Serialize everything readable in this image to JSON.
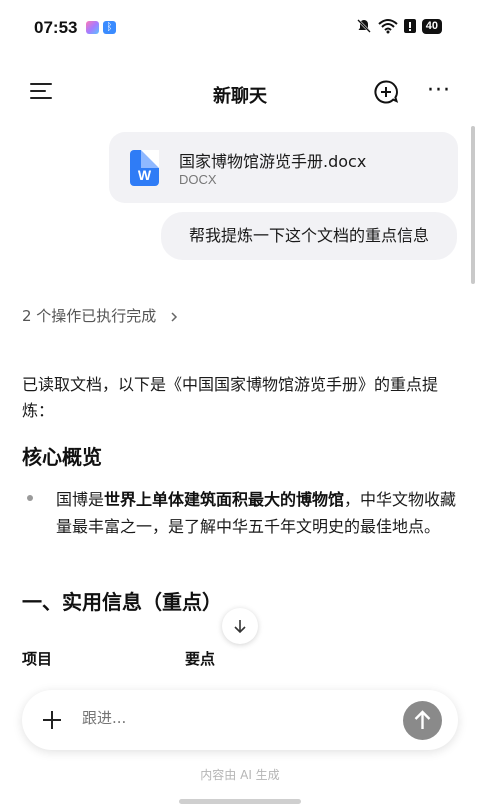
{
  "status_bar": {
    "time": "07:53",
    "battery": "40",
    "icons": [
      "app-notification-icon",
      "bluetooth-icon",
      "mute-icon",
      "wifi-icon",
      "alert-icon",
      "battery-icon"
    ]
  },
  "header": {
    "title": "新聊天",
    "menu_icon": "menu-icon",
    "new_chat_icon": "add-circle-icon",
    "more": "···"
  },
  "conversation": {
    "file": {
      "name": "国家博物馆游览手册.docx",
      "type": "DOCX",
      "icon_letter": "W",
      "icon_color": "#2f7cf6"
    },
    "user_message": "帮我提炼一下这个文档的重点信息",
    "ops_done": "2 个操作已执行完成",
    "response": {
      "intro": "已读取文档，以下是《中国国家博物馆游览手册》的重点提炼：",
      "heading_core": "核心概览",
      "bullet_prefix": "国博是",
      "bullet_bold": "世界上单体建筑面积最大的博物馆",
      "bullet_suffix": "，中华文物收藏量最丰富之一，是了解中华五千年文明史的最佳地点。",
      "heading_section": "一、实用信息（重点）",
      "table_headers": [
        "项目",
        "要点"
      ]
    }
  },
  "input": {
    "placeholder": "跟进...",
    "plus_icon": "plus-icon",
    "send_icon": "arrow-up-icon"
  },
  "footer_note": "内容由 AI 生成",
  "colors": {
    "bubble": "#f2f2f5",
    "send_button": "#8a8a8a",
    "docx_blue": "#2f7cf6"
  }
}
